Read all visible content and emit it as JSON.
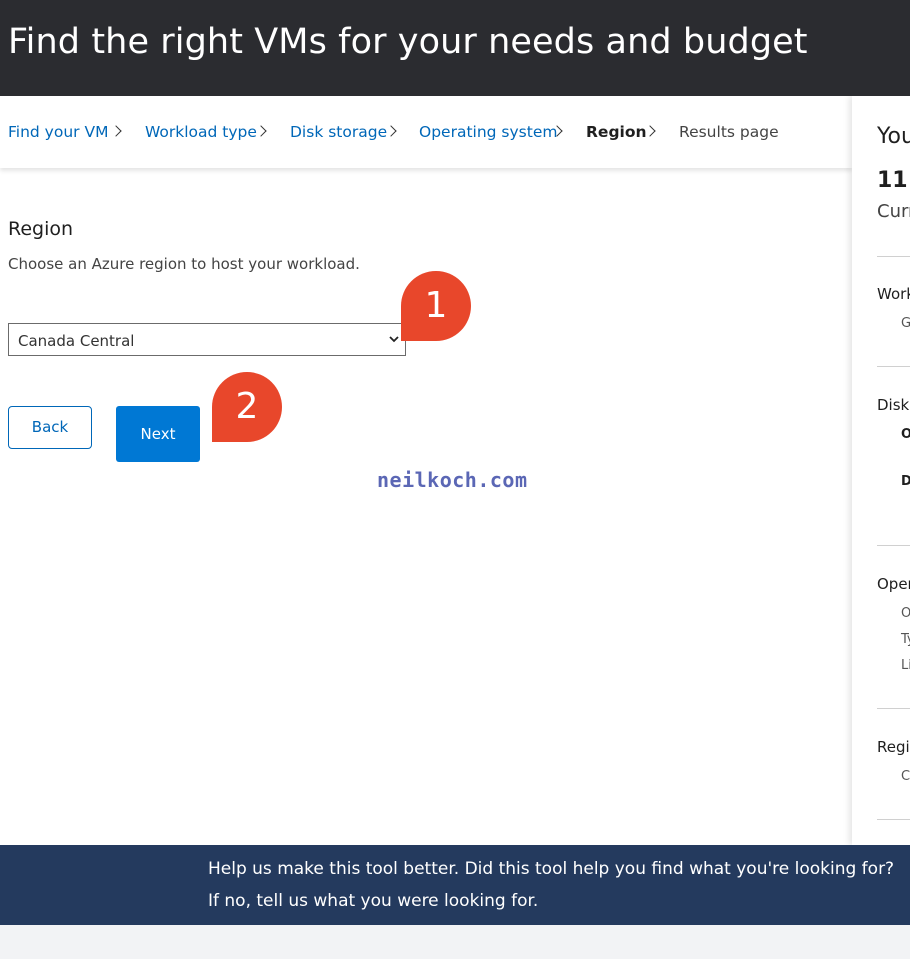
{
  "header": {
    "title": "Find the right VMs for your needs and budget"
  },
  "breadcrumb": {
    "items": [
      {
        "label": "Find your VM"
      },
      {
        "label": "Workload type"
      },
      {
        "label": "Disk storage"
      },
      {
        "label": "Operating system"
      },
      {
        "label": "Region"
      },
      {
        "label": "Results page"
      }
    ]
  },
  "section": {
    "title": "Region",
    "description": "Choose an Azure region to host your workload."
  },
  "region_select": {
    "selected": "Canada Central"
  },
  "buttons": {
    "back": "Back",
    "next": "Next"
  },
  "annotations": {
    "step1": "1",
    "step2": "2",
    "color": "#e8472b"
  },
  "watermark": "neilkoch.com",
  "summary_panel": {
    "title": "You",
    "count": "11",
    "subtitle": "Curr",
    "sections": [
      {
        "label": "Work",
        "items": [
          "G"
        ]
      },
      {
        "label": "Disk",
        "items": [
          "O",
          "D"
        ]
      },
      {
        "label": "Oper",
        "items": [
          "O",
          "Ty",
          "Li"
        ]
      },
      {
        "label": "Regi",
        "items": [
          "C"
        ]
      }
    ]
  },
  "feedback_banner": {
    "line1": "Help us make this tool better. Did this tool help you find what you're looking for?",
    "line2": "If no, tell us what you were looking for."
  },
  "colors": {
    "header_bg": "#2b2c30",
    "link": "#0067b8",
    "primary_button": "#0078d4",
    "banner_bg": "#243a5e"
  }
}
